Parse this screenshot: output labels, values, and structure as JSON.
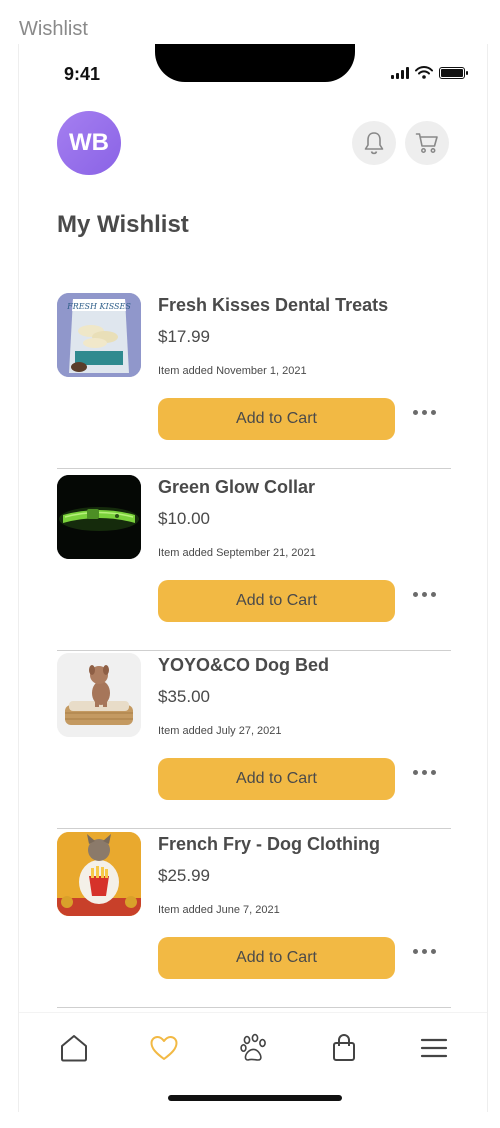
{
  "frame_label": "Wishlist",
  "status_bar": {
    "time": "9:41"
  },
  "header": {
    "avatar_initials": "WB"
  },
  "page_title": "My Wishlist",
  "colors": {
    "accent": "#f2b944",
    "avatar": "#9b74ee",
    "active_tab": "#f2b944",
    "text": "#4a4a4a"
  },
  "items": [
    {
      "name": "Fresh Kisses Dental Treats",
      "price": "$17.99",
      "added": "Item added November 1, 2021",
      "button": "Add to Cart",
      "image_label": "FRESH KISSES"
    },
    {
      "name": "Green Glow Collar",
      "price": "$10.00",
      "added": "Item added September 21, 2021",
      "button": "Add to Cart"
    },
    {
      "name": "YOYO&CO Dog Bed",
      "price": "$35.00",
      "added": "Item added July 27, 2021",
      "button": "Add to Cart"
    },
    {
      "name": "French Fry - Dog Clothing",
      "price": "$25.99",
      "added": "Item added June 7, 2021",
      "button": "Add to Cart"
    }
  ],
  "tabs": [
    {
      "icon": "home-icon"
    },
    {
      "icon": "heart-icon",
      "active": true
    },
    {
      "icon": "paw-icon"
    },
    {
      "icon": "shopping-bag-icon"
    },
    {
      "icon": "menu-icon"
    }
  ]
}
